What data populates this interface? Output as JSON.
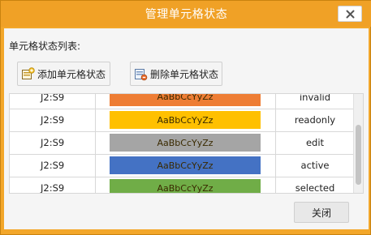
{
  "window": {
    "title": "管理单元格状态",
    "close_icon": "close-icon"
  },
  "list_label": "单元格状态列表:",
  "toolbar": {
    "add_label": "添加单元格状态",
    "add_icon": "add-state-icon",
    "delete_label": "删除单元格状态",
    "delete_icon": "delete-state-icon"
  },
  "grid": {
    "rows": [
      {
        "range": "J2:S9",
        "style_text": "AaBbCcYyZz",
        "style_color": "#ee7d34",
        "state": "invalid"
      },
      {
        "range": "J2:S9",
        "style_text": "AaBbCcYyZz",
        "style_color": "#ffc000",
        "state": "readonly"
      },
      {
        "range": "J2:S9",
        "style_text": "AaBbCcYyZz",
        "style_color": "#a5a5a5",
        "state": "edit"
      },
      {
        "range": "J2:S9",
        "style_text": "AaBbCcYyZz",
        "style_color": "#4472c4",
        "state": "active"
      },
      {
        "range": "J2:S9",
        "style_text": "AaBbCcYyZz",
        "style_color": "#70ad47",
        "state": "selected"
      }
    ]
  },
  "footer": {
    "close_label": "关闭"
  },
  "colors": {
    "titlebar": "#f0a126",
    "window_border": "#f3a72a"
  }
}
